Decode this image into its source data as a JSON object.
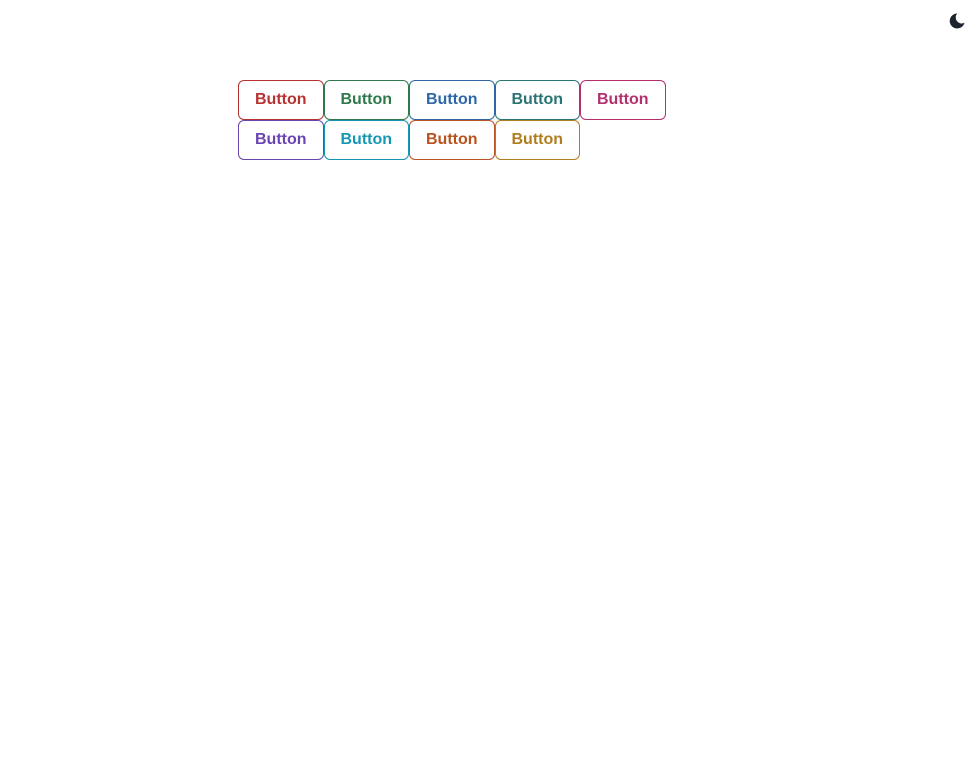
{
  "theme_toggle": {
    "icon": "moon-icon",
    "color": "#1e2330"
  },
  "buttons": [
    {
      "label": "Button",
      "color": "#b83232"
    },
    {
      "label": "Button",
      "color": "#2f7a4b"
    },
    {
      "label": "Button",
      "color": "#2e67a8"
    },
    {
      "label": "Button",
      "color": "#2a7473"
    },
    {
      "label": "Button",
      "color": "#b3306e"
    },
    {
      "label": "Button",
      "color": "#6a44b0"
    },
    {
      "label": "Button",
      "color": "#1597b4"
    },
    {
      "label": "Button",
      "color": "#b8521f"
    },
    {
      "label": "Button",
      "color": "#b07d1f"
    }
  ]
}
